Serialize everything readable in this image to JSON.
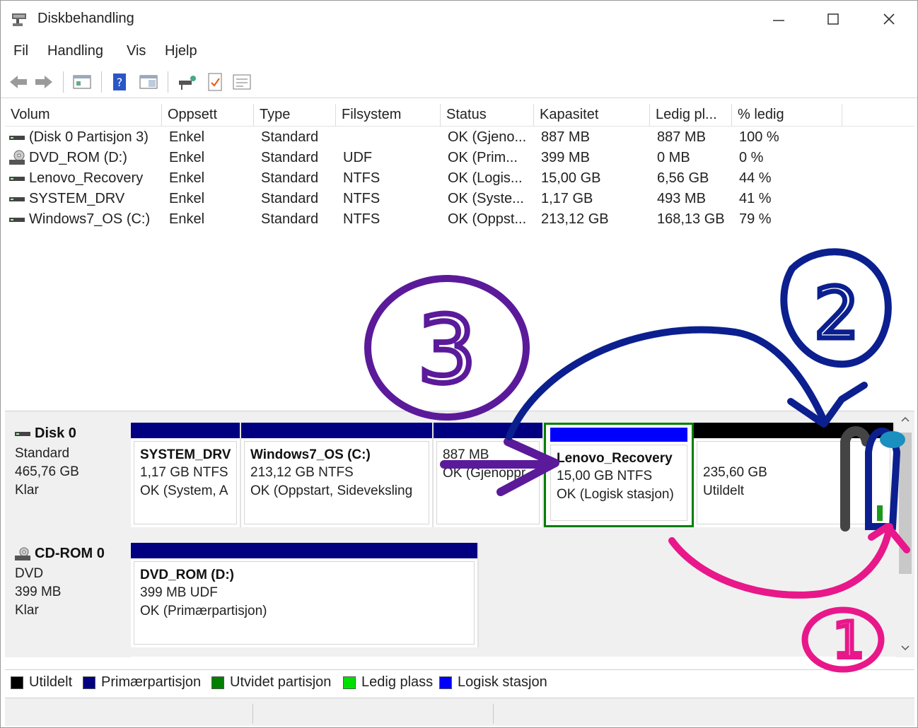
{
  "window": {
    "title": "Diskbehandling"
  },
  "menu": {
    "items": [
      "Fil",
      "Handling",
      "Vis",
      "Hjelp"
    ]
  },
  "list": {
    "columns": [
      "Volum",
      "Oppsett",
      "Type",
      "Filsystem",
      "Status",
      "Kapasitet",
      "Ledig pl...",
      "% ledig"
    ],
    "rows": [
      {
        "volume": "(Disk 0 Partisjon 3)",
        "layout": "Enkel",
        "type": "Standard",
        "fs": "",
        "status": "OK (Gjeno...",
        "capacity": "887 MB",
        "free": "887 MB",
        "pct": "100 %"
      },
      {
        "volume": "DVD_ROM (D:)",
        "layout": "Enkel",
        "type": "Standard",
        "fs": "UDF",
        "status": "OK (Prim...",
        "capacity": "399 MB",
        "free": "0 MB",
        "pct": "0 %"
      },
      {
        "volume": "Lenovo_Recovery",
        "layout": "Enkel",
        "type": "Standard",
        "fs": "NTFS",
        "status": "OK (Logis...",
        "capacity": "15,00 GB",
        "free": "6,56 GB",
        "pct": "44 %"
      },
      {
        "volume": "SYSTEM_DRV",
        "layout": "Enkel",
        "type": "Standard",
        "fs": "NTFS",
        "status": "OK (Syste...",
        "capacity": "1,17 GB",
        "free": "493 MB",
        "pct": "41 %"
      },
      {
        "volume": "Windows7_OS (C:)",
        "layout": "Enkel",
        "type": "Standard",
        "fs": "NTFS",
        "status": "OK (Oppst...",
        "capacity": "213,12 GB",
        "free": "168,13 GB",
        "pct": "79 %"
      }
    ]
  },
  "disks": [
    {
      "name": "Disk 0",
      "kind": "Standard",
      "size": "465,76 GB",
      "state": "Klar",
      "partitions": [
        {
          "name": "SYSTEM_DRV",
          "detail": "1,17 GB NTFS",
          "status": "OK (System, A"
        },
        {
          "name": "Windows7_OS  (C:)",
          "detail": "213,12 GB NTFS",
          "status": "OK (Oppstart, Sideveksling"
        },
        {
          "name": "",
          "detail": "887 MB",
          "status": "OK (Gjenoppr"
        },
        {
          "name": "Lenovo_Recovery",
          "detail": "15,00 GB NTFS",
          "status": "OK (Logisk stasjon)"
        },
        {
          "name": "",
          "detail": "235,60 GB",
          "status": "Utildelt"
        }
      ]
    },
    {
      "name": "CD-ROM 0",
      "kind": "DVD",
      "size": "399 MB",
      "state": "Klar",
      "partitions": [
        {
          "name": "DVD_ROM  (D:)",
          "detail": "399 MB UDF",
          "status": "OK (Primærpartisjon)"
        }
      ]
    }
  ],
  "legend": {
    "items": [
      {
        "label": "Utildelt",
        "color": "#000000"
      },
      {
        "label": "Primærpartisjon",
        "color": "#000080"
      },
      {
        "label": "Utvidet partisjon",
        "color": "#008000"
      },
      {
        "label": "Ledig plass",
        "color": "#00e000"
      },
      {
        "label": "Logisk stasjon",
        "color": "#0000ff"
      }
    ]
  },
  "colors": {
    "primary_bar": "#000080",
    "logical_bar": "#0000ff",
    "unallocated_bar": "#000000",
    "extended_border": "#008000",
    "annotation_pink": "#e8178a",
    "annotation_navy": "#0b1f8f",
    "annotation_purple": "#5b1a9a"
  },
  "annotations": {
    "labels": [
      "1",
      "2",
      "3"
    ]
  }
}
